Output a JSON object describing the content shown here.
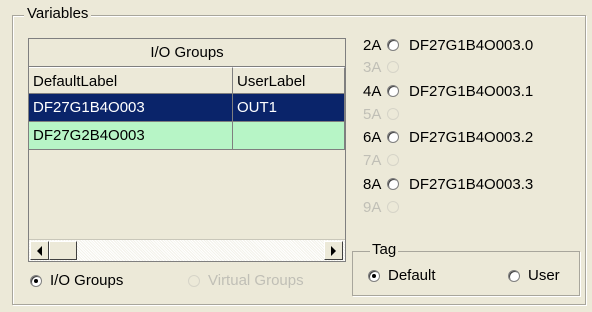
{
  "variables": {
    "title": "Variables"
  },
  "grid": {
    "group_header": "I/O Groups",
    "columns": [
      "DefaultLabel",
      "UserLabel"
    ],
    "rows": [
      {
        "default_label": "DF27G1B4O003",
        "user_label": "OUT1",
        "state": "selected"
      },
      {
        "default_label": "DF27G2B4O003",
        "user_label": "",
        "state": "highlighted"
      }
    ]
  },
  "group_type": {
    "options": [
      {
        "label": "I/O Groups",
        "checked": true,
        "enabled": true
      },
      {
        "label": "Virtual Groups",
        "checked": false,
        "enabled": false
      }
    ]
  },
  "channels": [
    {
      "num": "2A",
      "label": "DF27G1B4O003.0",
      "enabled": true
    },
    {
      "num": "3A",
      "label": "",
      "enabled": false
    },
    {
      "num": "4A",
      "label": "DF27G1B4O003.1",
      "enabled": true
    },
    {
      "num": "5A",
      "label": "",
      "enabled": false
    },
    {
      "num": "6A",
      "label": "DF27G1B4O003.2",
      "enabled": true
    },
    {
      "num": "7A",
      "label": "",
      "enabled": false
    },
    {
      "num": "8A",
      "label": "DF27G1B4O003.3",
      "enabled": true
    },
    {
      "num": "9A",
      "label": "",
      "enabled": false
    }
  ],
  "tag": {
    "title": "Tag",
    "options": [
      {
        "label": "Default",
        "checked": true
      },
      {
        "label": "User",
        "checked": false
      }
    ]
  }
}
